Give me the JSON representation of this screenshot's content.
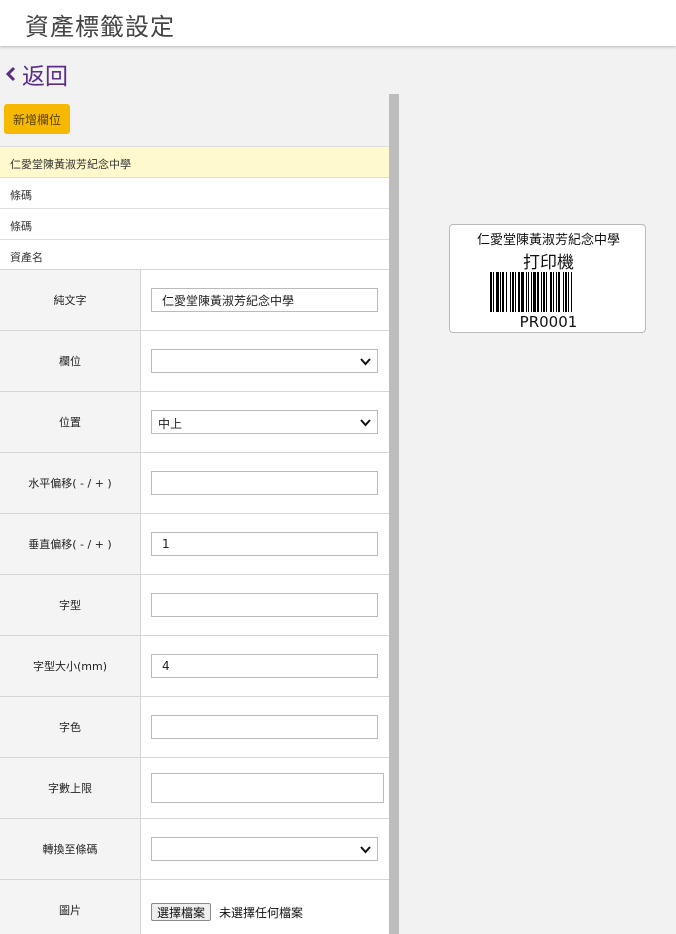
{
  "header": {
    "title": "資產標籤設定"
  },
  "nav": {
    "back_label": "返回"
  },
  "toolbar": {
    "add_field_label": "新增欄位"
  },
  "field_list": [
    {
      "label": "仁愛堂陳黃淑芳紀念中學",
      "active": true
    },
    {
      "label": "條碼",
      "active": false
    },
    {
      "label": "條碼",
      "active": false
    },
    {
      "label": "資產名",
      "active": false
    }
  ],
  "form": {
    "plain_text": {
      "label": "純文字",
      "value": "仁愛堂陳黃淑芳紀念中學"
    },
    "field": {
      "label": "欄位",
      "value": ""
    },
    "position": {
      "label": "位置",
      "value": "中上"
    },
    "h_offset": {
      "label": "水平偏移( - / + )",
      "value": ""
    },
    "v_offset": {
      "label": "垂直偏移( - / + )",
      "value": "1"
    },
    "font": {
      "label": "字型",
      "value": ""
    },
    "font_size": {
      "label": "字型大小(mm)",
      "value": "4"
    },
    "font_color": {
      "label": "字色",
      "value": ""
    },
    "max_chars": {
      "label": "字數上限",
      "value": ""
    },
    "convert_barcode": {
      "label": "轉換至條碼",
      "value": ""
    },
    "image": {
      "label": "圖片",
      "button_label": "選擇檔案",
      "status": "未選擇任何檔案"
    }
  },
  "preview": {
    "school": "仁愛堂陳黃淑芳紀念中學",
    "asset_name": "打印機",
    "code": "PR0001"
  },
  "colors": {
    "accent": "#5b2d86",
    "button": "#f7b900",
    "active_row": "#fffacd"
  }
}
